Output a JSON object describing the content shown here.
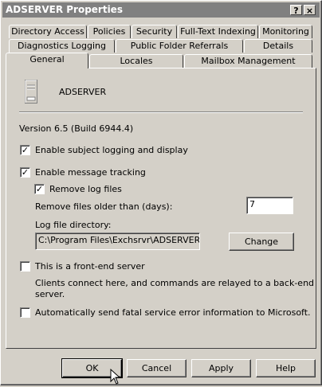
{
  "window": {
    "title": "ADSERVER Properties",
    "help_btn": "?",
    "close_btn": "×"
  },
  "tabs_row1": [
    "Directory Access",
    "Policies",
    "Security",
    "Full-Text Indexing",
    "Monitoring"
  ],
  "tabs_row2": [
    "Diagnostics Logging",
    "Public Folder Referrals",
    "Details"
  ],
  "tabs_row3": [
    "General",
    "Locales",
    "Mailbox Management"
  ],
  "server_name": "ADSERVER",
  "version": "Version 6.5 (Build 6944.4)",
  "options": {
    "subject_logging": {
      "label": "Enable subject logging and display",
      "checked": "✓"
    },
    "message_tracking": {
      "label": "Enable message tracking",
      "checked": "✓"
    },
    "remove_log_files": {
      "label": "Remove log files",
      "checked": "✓"
    },
    "remove_older_label": "Remove files older than (days):",
    "remove_older_value": "7",
    "log_dir_label": "Log file directory:",
    "log_dir_value": "C:\\Program Files\\Exchsrvr\\ADSERVER.log",
    "change_btn": "Change",
    "front_end": {
      "label": "This is a front-end server",
      "checked": ""
    },
    "front_end_desc_1": "Clients connect here, and commands are relayed to a back-end",
    "front_end_desc_2": "server.",
    "auto_send": {
      "label": "Automatically send fatal service error information to Microsoft.",
      "checked": ""
    }
  },
  "buttons": {
    "ok": "OK",
    "cancel": "Cancel",
    "apply": "Apply",
    "help": "Help"
  }
}
